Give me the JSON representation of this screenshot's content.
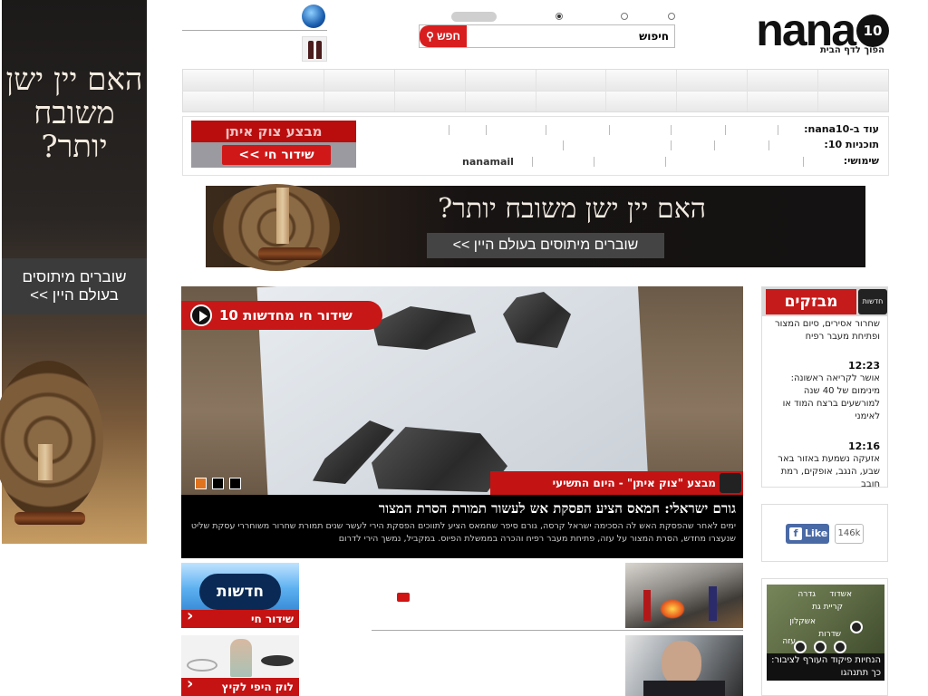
{
  "brand": {
    "logo_text": "nana",
    "logo_badge": "10",
    "slogan": "הפוך לדף הבית"
  },
  "search": {
    "value": "חיפוש",
    "button_label": "חפש"
  },
  "sky_ad": {
    "headline": "האם יין ישן משובח יותר?",
    "cta": "שוברים מיתוסים בעולם היין >>"
  },
  "more": {
    "row1_label": "עוד ב-nana10:",
    "row2_label": "תוכניות 10:",
    "row3_label": "שימושי:",
    "mail_text": "nanamail"
  },
  "small_banner": {
    "title": "מבצע צוק איתן",
    "cta": "שידור חי >>"
  },
  "leader_ad": {
    "headline": "האם יין ישן משובח יותר?",
    "cta": "שוברים מיתוסים בעולם היין >>"
  },
  "hero": {
    "live_label": "שידור חי מחדשות 10",
    "operation_label": "מבצע \"צוק איתן\" - היום התשיעי",
    "headline": "גורם ישראלי: חמאס הציע הפסקת אש לעשור תמורת הסרת המצור",
    "summary": "ימים לאחר שהפסקת האש לה הסכימה ישראל קרסה, גורם סיפר שחמאס הציע לתווכים הפסקת הירי לעשר שנים תמורת שחרור משוחררי עסקת שליט שנעצרו מחדש, הסרת המצור על עזה, פתיחת מעבר רפיח והכרה בממשלת הפיוס. במקביל, נמשך הירי לדרום"
  },
  "flashes": {
    "title": "מבזקים",
    "logo": "חדשות",
    "items": [
      {
        "time": "",
        "text": "שחרור אסירים, סיום המצור ופתיחת מעבר רפיח"
      },
      {
        "time": "12:23",
        "text": "אושר לקריאה ראשונה: מינימום של 40 שנה למורשעים ברצח המוד או לאימני"
      },
      {
        "time": "12:16",
        "text": "אזעקה נשמעת באזור באר שבע, הנגב, אופקים, רמת חובב"
      }
    ]
  },
  "facebook": {
    "like": "Like",
    "count": "146k"
  },
  "tiles": {
    "news_label": "חדשות",
    "live_label": "שידור חי",
    "fashion_label": "לוק היפי לקיץ"
  },
  "map": {
    "caption": "הנחיות פיקוד העורף לציבור: כך תתנהגו",
    "cities": [
      "גדרה",
      "אשדוד",
      "קריית גת",
      "אשקלון",
      "שדרות",
      "עזה"
    ]
  }
}
